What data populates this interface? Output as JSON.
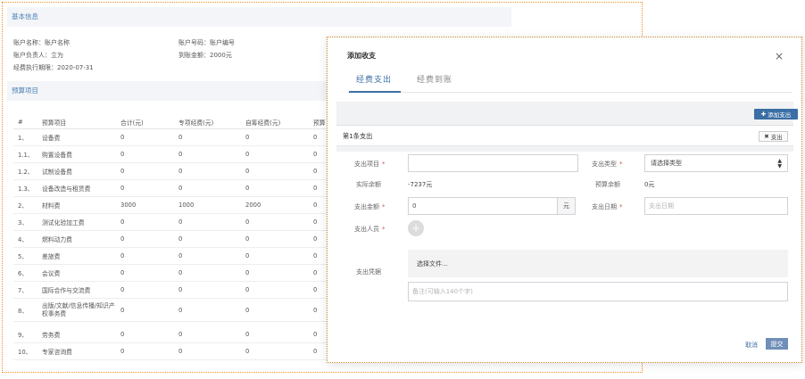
{
  "background": {
    "basic_info_title": "基本信息",
    "account_name": "账户名称：账户名称",
    "account_number": "账户号码：账户编号",
    "account_owner": "账户负责人：立为",
    "arrival_amount": "到账金额：2000元",
    "execution_period": "经费执行期限：2020-07-31",
    "budget_title": "预算项目",
    "table": {
      "headers": [
        "#",
        "预算项目",
        "合计(元)",
        "专项经费(元)",
        "自筹经费(元)",
        "预算"
      ],
      "rows": [
        [
          "1、",
          "设备费",
          "0",
          "0",
          "0",
          "0"
        ],
        [
          "1.1、",
          "购置设备费",
          "0",
          "0",
          "0",
          "0"
        ],
        [
          "1.2、",
          "试制设备费",
          "0",
          "0",
          "0",
          "0"
        ],
        [
          "1.3、",
          "设备改造与租赁费",
          "0",
          "0",
          "0",
          "0"
        ],
        [
          "2、",
          "材料费",
          "3000",
          "1000",
          "2000",
          "0"
        ],
        [
          "3、",
          "测试化验加工费",
          "0",
          "0",
          "0",
          "0"
        ],
        [
          "4、",
          "燃料动力费",
          "0",
          "0",
          "0",
          "0"
        ],
        [
          "5、",
          "差旅费",
          "0",
          "0",
          "0",
          "0"
        ],
        [
          "6、",
          "会议费",
          "0",
          "0",
          "0",
          "0"
        ],
        [
          "7、",
          "国际合作与交流费",
          "0",
          "0",
          "0",
          "0"
        ],
        [
          "8、",
          "出版/文献/信息传播/知识产权事务费",
          "0",
          "0",
          "0",
          "0"
        ],
        [
          "9、",
          "劳务费",
          "0",
          "0",
          "0",
          "0"
        ],
        [
          "10、",
          "专家咨询费",
          "0",
          "0",
          "0",
          "0"
        ]
      ]
    }
  },
  "modal": {
    "title": "添加收支",
    "close_icon": "×",
    "tabs": [
      "经费支出",
      "经费到账"
    ],
    "add_expense_label": "添加支出",
    "item_title": "第1条支出",
    "delete_label": "支出",
    "form": {
      "item_label": "支出项目",
      "item_value": "",
      "type_label": "支出类型",
      "type_selected": "请选择类型",
      "actual_balance_label": "实际余额",
      "actual_balance_value": "-7237元",
      "budget_balance_label": "预算余额",
      "budget_balance_value": "0元",
      "amount_label": "支出金额",
      "amount_value": "0",
      "amount_unit": "元",
      "date_label": "支出日期",
      "date_placeholder": "支出日期",
      "person_label": "支出人员",
      "voucher_label": "支出凭据",
      "file_label": "选择文件...",
      "remark_placeholder": "备注(可输入140个字)",
      "required_mark": "*"
    },
    "cancel_label": "取消",
    "submit_label": "提交"
  },
  "colors": {
    "accent": "#3f6fa6",
    "required": "#d9534f",
    "highlight_border": "#e8922a"
  }
}
